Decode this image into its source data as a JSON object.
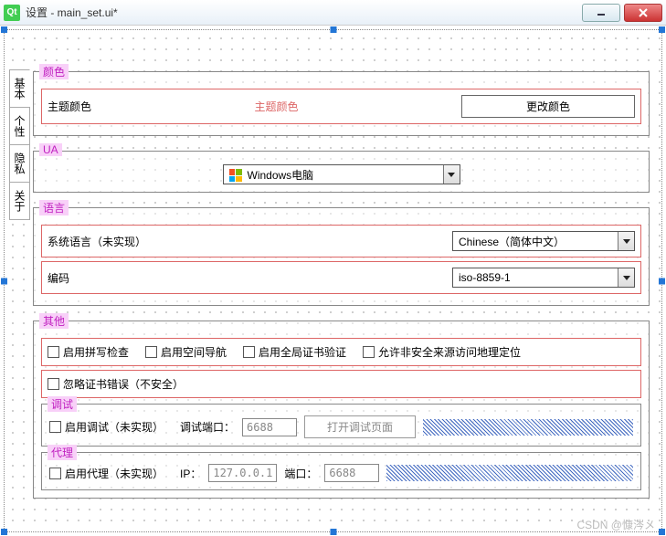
{
  "window": {
    "title": "设置 - main_set.ui*",
    "qt": "Qt"
  },
  "tabs": [
    "基本",
    "个性",
    "隐私",
    "关于"
  ],
  "groups": {
    "color": {
      "legend": "颜色",
      "theme_label": "主题颜色",
      "theme_placeholder": "主题颜色",
      "change_btn": "更改颜色"
    },
    "ua": {
      "legend": "UA",
      "value": "Windows电脑"
    },
    "lang": {
      "legend": "语言",
      "sys_label": "系统语言（未实现）",
      "sys_value": "Chinese（简体中文）",
      "enc_label": "编码",
      "enc_value": "iso-8859-1"
    },
    "other": {
      "legend": "其他",
      "chk_spell": "启用拼写检查",
      "chk_space": "启用空间导航",
      "chk_cert": "启用全局证书验证",
      "chk_geo": "允许非安全来源访问地理定位",
      "chk_ignore": "忽略证书错误（不安全）"
    },
    "debug": {
      "legend": "调试",
      "chk": "启用调试（未实现）",
      "port_label": "调试端口：",
      "port": "6688",
      "open_btn": "打开调试页面"
    },
    "proxy": {
      "legend": "代理",
      "chk": "启用代理（未实现）",
      "ip_label": "IP：",
      "ip": "127.0.0.1",
      "port_label": "端口：",
      "port": "6688"
    }
  },
  "watermark": "CSDN @慷涔メ"
}
